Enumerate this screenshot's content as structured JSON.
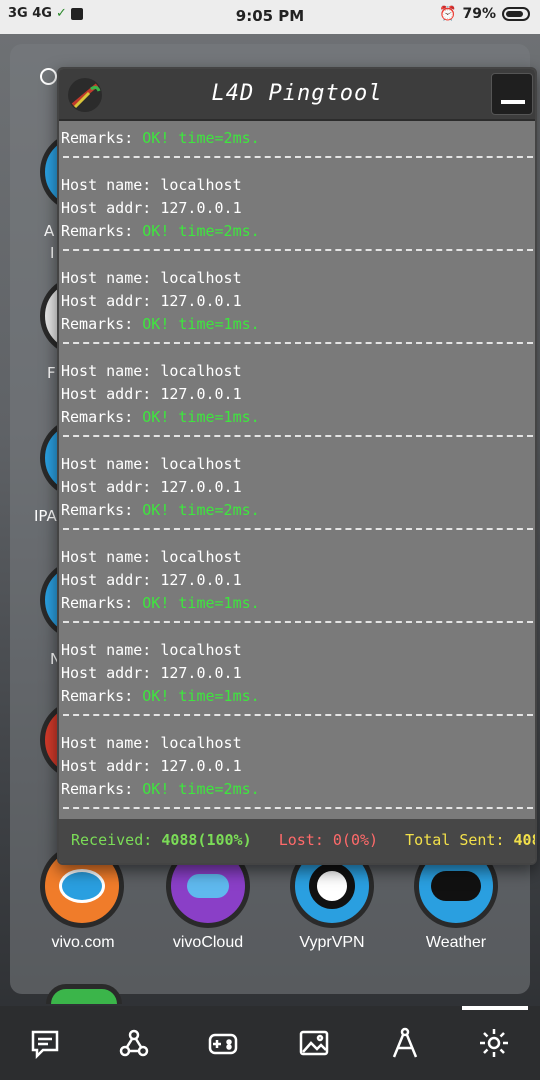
{
  "status_bar": {
    "network": "3G 4G",
    "time": "9:05 PM",
    "battery": "79%"
  },
  "popup": {
    "title": "L4D Pingtool",
    "first_remark": {
      "label": "Remarks:",
      "value": "OK! time=2ms."
    },
    "entries": [
      {
        "host_name_label": "Host name:",
        "host_name": "localhost",
        "host_addr_label": "Host addr:",
        "host_addr": "127.0.0.1",
        "remarks_label": "Remarks:",
        "remarks": "OK! time=2ms."
      },
      {
        "host_name_label": "Host name:",
        "host_name": "localhost",
        "host_addr_label": "Host addr:",
        "host_addr": "127.0.0.1",
        "remarks_label": "Remarks:",
        "remarks": "OK! time=1ms."
      },
      {
        "host_name_label": "Host name:",
        "host_name": "localhost",
        "host_addr_label": "Host addr:",
        "host_addr": "127.0.0.1",
        "remarks_label": "Remarks:",
        "remarks": "OK! time=1ms."
      },
      {
        "host_name_label": "Host name:",
        "host_name": "localhost",
        "host_addr_label": "Host addr:",
        "host_addr": "127.0.0.1",
        "remarks_label": "Remarks:",
        "remarks": "OK! time=2ms."
      },
      {
        "host_name_label": "Host name:",
        "host_name": "localhost",
        "host_addr_label": "Host addr:",
        "host_addr": "127.0.0.1",
        "remarks_label": "Remarks:",
        "remarks": "OK! time=1ms."
      },
      {
        "host_name_label": "Host name:",
        "host_name": "localhost",
        "host_addr_label": "Host addr:",
        "host_addr": "127.0.0.1",
        "remarks_label": "Remarks:",
        "remarks": "OK! time=1ms."
      },
      {
        "host_name_label": "Host name:",
        "host_name": "localhost",
        "host_addr_label": "Host addr:",
        "host_addr": "127.0.0.1",
        "remarks_label": "Remarks:",
        "remarks": "OK! time=2ms."
      }
    ],
    "footer": {
      "received_label": "Received:",
      "received_value": "4088(100%)",
      "lost_label": "Lost:",
      "lost_value": "0(0%)",
      "total_label": "Total Sent:",
      "total_value": "408"
    }
  },
  "side_labels": [
    "A",
    "I",
    "F",
    "IPA",
    "N"
  ],
  "apps": [
    {
      "label": "vivo.com",
      "icon": "vivo-icon",
      "color": "#f07c2a"
    },
    {
      "label": "vivoCloud",
      "icon": "cloud-icon",
      "color": "#8a3fc7"
    },
    {
      "label": "VyprVPN",
      "icon": "vyprvpn-icon",
      "color": "#2a9fe0"
    },
    {
      "label": "Weather",
      "icon": "weather-icon",
      "color": "#2a9fe0"
    }
  ],
  "nav": [
    "chat-icon",
    "share-icon",
    "gamepad-icon",
    "image-icon",
    "compass-icon",
    "settings-icon"
  ],
  "colors": {
    "ok_green": "#3ee63e",
    "received_green": "#7bdc57",
    "lost_red": "#ff6a6a",
    "total_yellow": "#f2e04a"
  }
}
